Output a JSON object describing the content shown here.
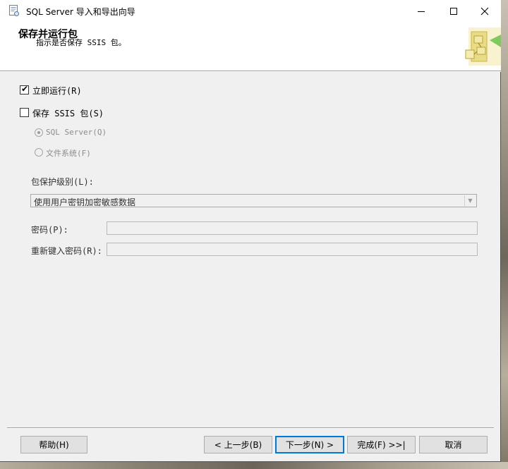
{
  "window": {
    "title": "SQL Server 导入和导出向导",
    "minimize_glyph": "—",
    "maximize_glyph": "☐",
    "close_glyph": "✕"
  },
  "header": {
    "title": "保存并运行包",
    "subtitle": "指示是否保存 SSIS 包。"
  },
  "options": {
    "run_now": {
      "label": "立即运行(R)",
      "checked": true
    },
    "save_ssis": {
      "label": "保存 SSIS 包(S)",
      "checked": false
    },
    "sql_server": {
      "label": "SQL Server(Q)",
      "selected": true,
      "enabled": false
    },
    "file_system": {
      "label": "文件系统(F)",
      "selected": false,
      "enabled": false
    }
  },
  "protection": {
    "label": "包保护级别(L):",
    "selected": "使用用户密钥加密敏感数据"
  },
  "password": {
    "label": "密码(P):",
    "value": ""
  },
  "retype_password": {
    "label": "重新键入密码(R):",
    "value": ""
  },
  "buttons": {
    "help": "帮助(H)",
    "back": "< 上一步(B)",
    "next": "下一步(N) >",
    "finish": "完成(F) >>|",
    "cancel": "取消"
  },
  "icons": {
    "app": "wizard-app-icon",
    "header_art": "ssis-package-art-icon"
  }
}
